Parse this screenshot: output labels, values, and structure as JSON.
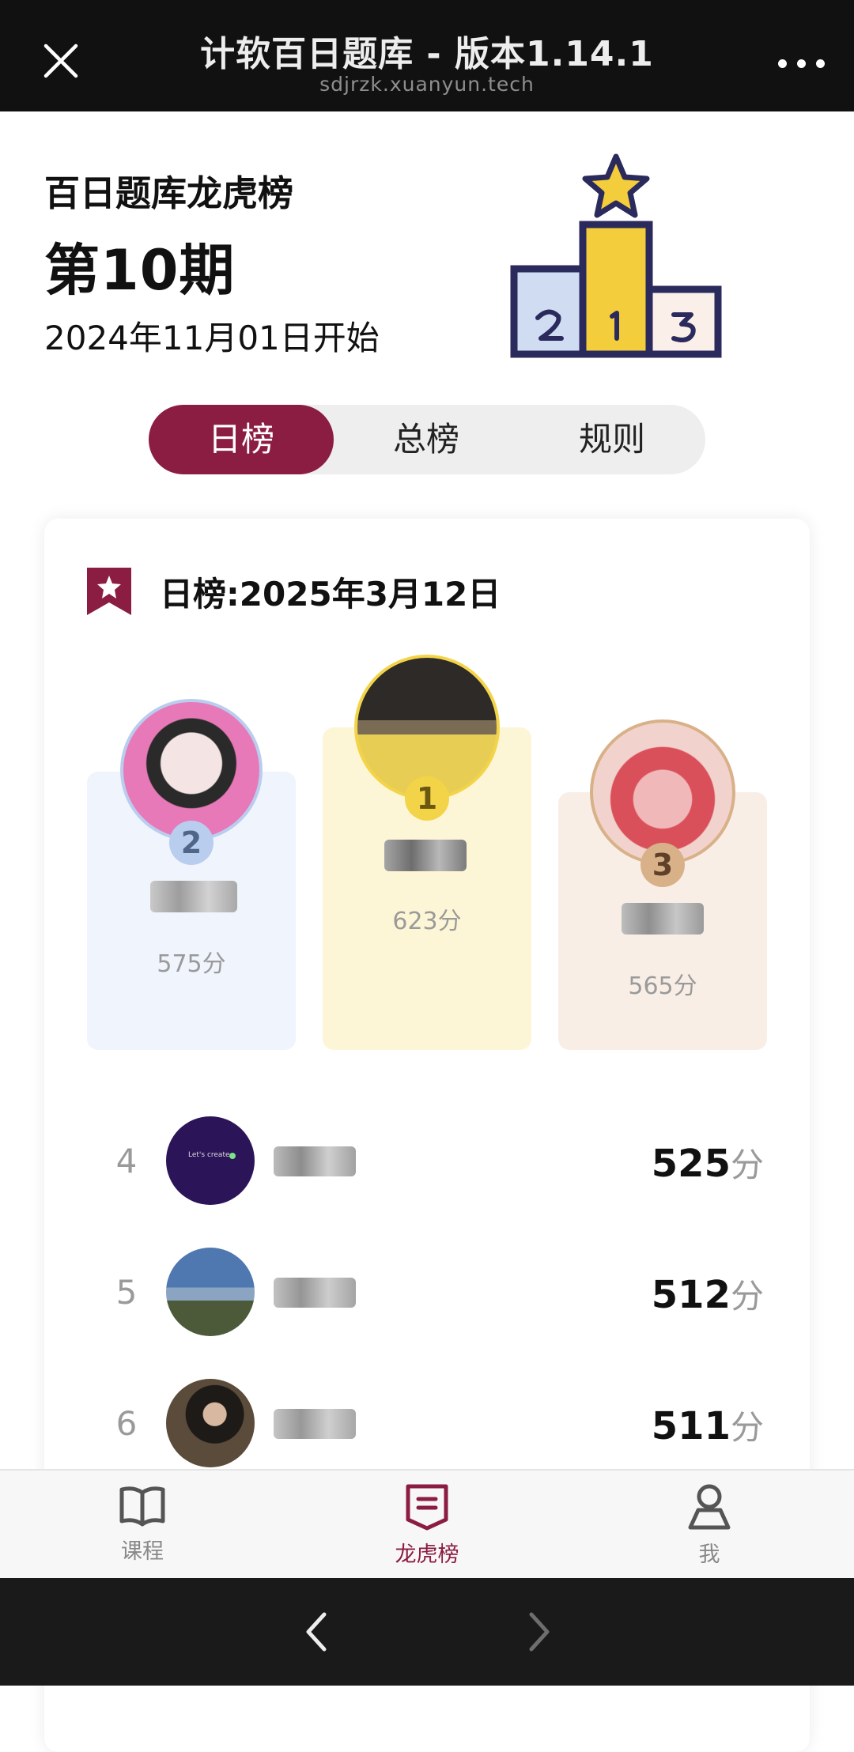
{
  "browser": {
    "title": "计软百日题库 - 版本1.14.1",
    "url": "sdjrzk.xuanyun.tech",
    "close_icon": "close-icon",
    "more_icon": "more-dots-icon"
  },
  "header": {
    "board_name": "百日题库龙虎榜",
    "issue": "第10期",
    "start_date": "2024年11月01日开始",
    "illustration": "podium-star-illustration"
  },
  "tabs": [
    {
      "label": "日榜",
      "active": true
    },
    {
      "label": "总榜",
      "active": false
    },
    {
      "label": "规则",
      "active": false
    }
  ],
  "leaderboard": {
    "title": "日榜:2025年3月12日",
    "icon": "bookmark-star-icon",
    "podium": [
      {
        "rank": "2",
        "score": "575分",
        "color": "#b9cdee"
      },
      {
        "rank": "1",
        "score": "623分",
        "color": "#f3d448"
      },
      {
        "rank": "3",
        "score": "565分",
        "color": "#d8b189"
      }
    ],
    "rows": [
      {
        "rank": "4",
        "score": "525",
        "unit": "分",
        "avatar_text": "Let's create"
      },
      {
        "rank": "5",
        "score": "512",
        "unit": "分"
      },
      {
        "rank": "6",
        "score": "511",
        "unit": "分"
      }
    ]
  },
  "bottom_nav": [
    {
      "label": "课程",
      "icon": "book-icon",
      "active": false
    },
    {
      "label": "龙虎榜",
      "icon": "leaderboard-icon",
      "active": true
    },
    {
      "label": "我",
      "icon": "person-icon",
      "active": false
    }
  ],
  "colors": {
    "accent": "#8b1c42",
    "gold": "#f3d448",
    "silver_blue": "#b9cdee",
    "bronze": "#d8b189"
  }
}
